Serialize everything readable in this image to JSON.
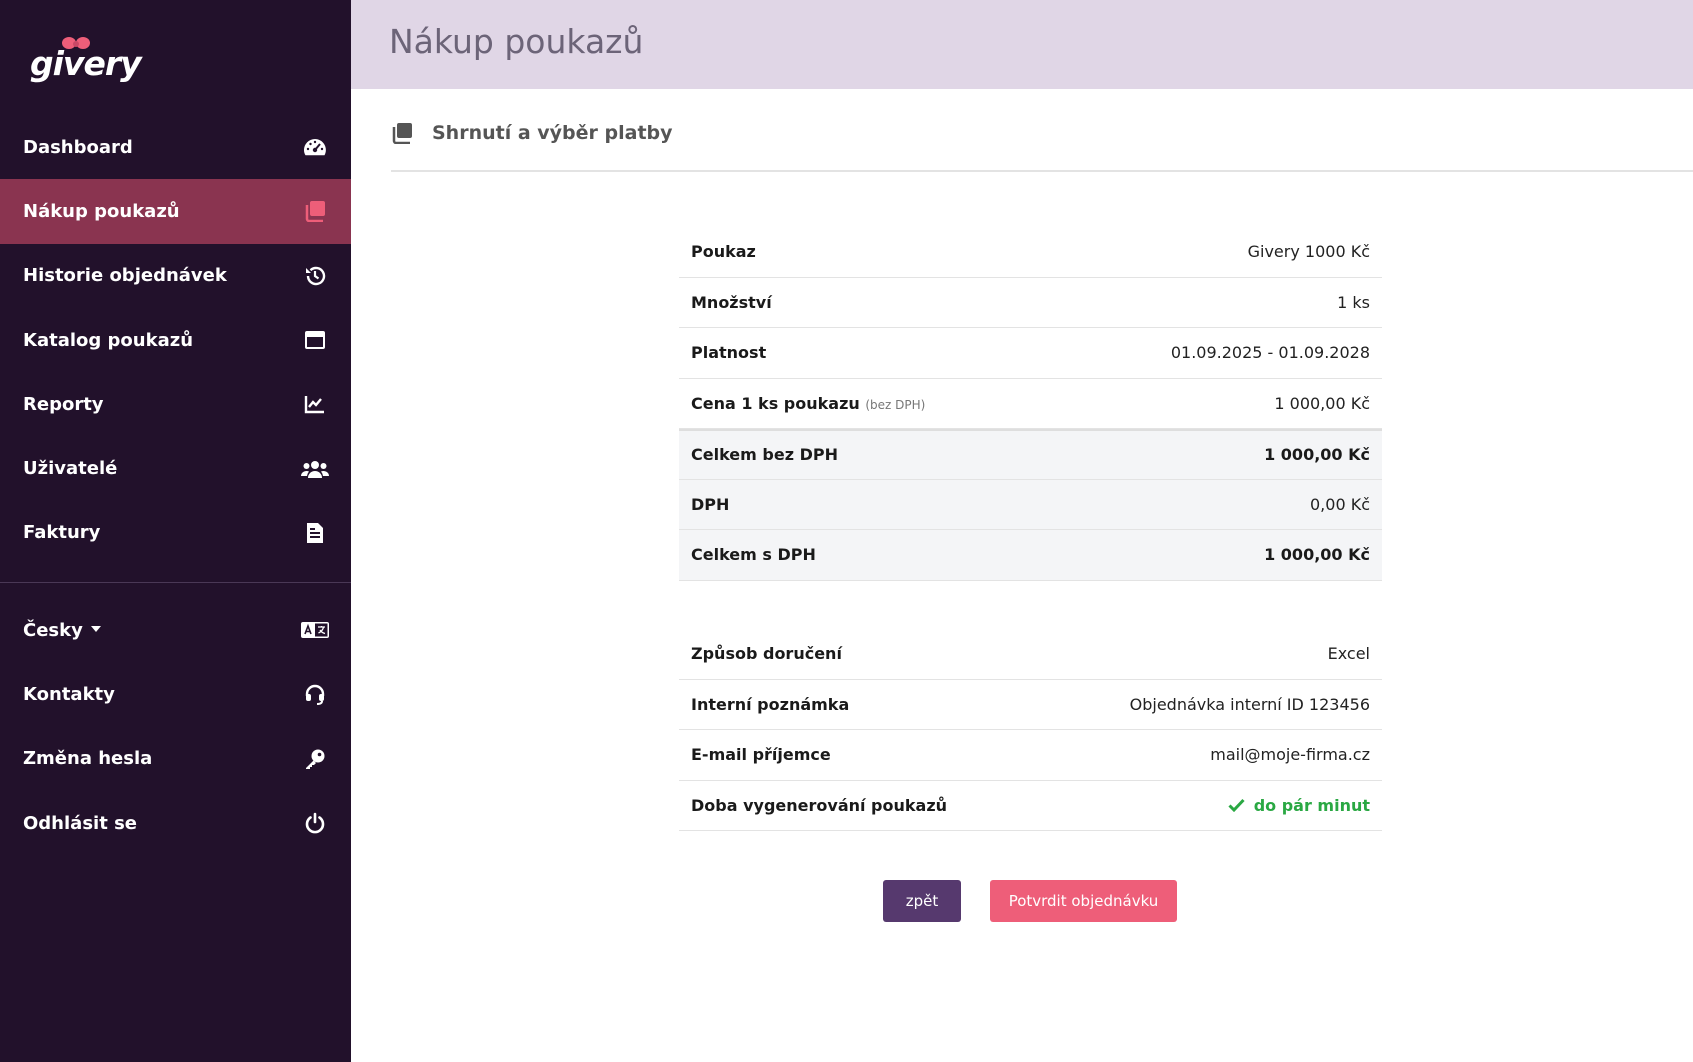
{
  "brand": {
    "logo_text": "givery"
  },
  "sidebar": {
    "items": [
      {
        "label": "Dashboard",
        "icon": "gauge-icon",
        "active": false
      },
      {
        "label": "Nákup poukazů",
        "icon": "vouchers-icon",
        "active": true
      },
      {
        "label": "Historie objednávek",
        "icon": "history-icon",
        "active": false
      },
      {
        "label": "Katalog poukazů",
        "icon": "card-icon",
        "active": false
      },
      {
        "label": "Reporty",
        "icon": "chart-line-icon",
        "active": false
      },
      {
        "label": "Uživatelé",
        "icon": "users-icon",
        "active": false
      },
      {
        "label": "Faktury",
        "icon": "invoice-icon",
        "active": false
      }
    ],
    "secondary": [
      {
        "label": "Česky",
        "icon": "translate-icon"
      },
      {
        "label": "Kontakty",
        "icon": "headset-icon"
      },
      {
        "label": "Změna hesla",
        "icon": "key-icon"
      },
      {
        "label": "Odhlásit se",
        "icon": "power-icon"
      }
    ]
  },
  "header": {
    "title": "Nákup poukazů"
  },
  "section": {
    "title": "Shrnutí a výběr platby",
    "icon": "vouchers-icon"
  },
  "summary": [
    {
      "label": "Poukaz",
      "value": "Givery 1000 Kč"
    },
    {
      "label": "Množství",
      "value": "1 ks"
    },
    {
      "label": "Platnost",
      "value": "01.09.2025 - 01.09.2028"
    },
    {
      "label": "Cena 1 ks poukazu",
      "note": "(bez DPH)",
      "value": "1 000,00 Kč"
    },
    {
      "label": "Celkem bez DPH",
      "value": "1 000,00 Kč"
    },
    {
      "label": "DPH",
      "value": "0,00 Kč"
    },
    {
      "label": "Celkem s DPH",
      "value": "1 000,00 Kč"
    }
  ],
  "delivery": [
    {
      "label": "Způsob doručení",
      "value": "Excel"
    },
    {
      "label": "Interní poznámka",
      "value": "Objednávka interní ID 123456"
    },
    {
      "label": "E-mail příjemce",
      "value": "mail@moje-firma.cz"
    },
    {
      "label": "Doba vygenerování poukazů",
      "value": "do pár minut"
    }
  ],
  "buttons": {
    "back": "zpět",
    "confirm": "Potvrdit objednávku"
  },
  "colors": {
    "sidebar": "#22112b",
    "active": "#8a3450",
    "accent": "#ee5e79",
    "header": "#e0d6e6",
    "back_button": "#56396e",
    "success": "#2aa843"
  }
}
